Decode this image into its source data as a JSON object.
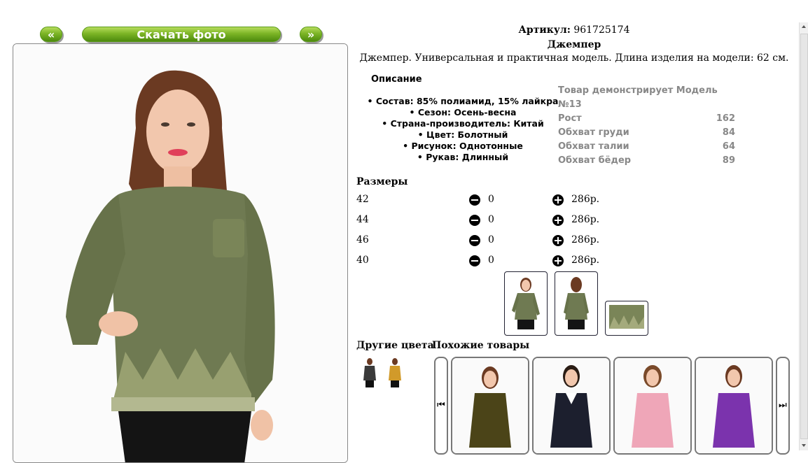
{
  "nav": {
    "prev_label": "«",
    "download_label": "Скачать фото",
    "next_label": "»"
  },
  "product": {
    "article_label": "Артикул:",
    "article_value": "961725174",
    "name": "Джемпер",
    "description": "Джемпер. Универсальная и практичная модель. Длина изделия на модели: 62 см."
  },
  "description_section": {
    "heading": "Описание",
    "properties": [
      "• Состав: 85% полиамид, 15% лайкра",
      "• Сезон: Осень-весна",
      "• Страна-производитель: Китай",
      "• Цвет: Болотный",
      "• Рисунок: Однотонные",
      "• Рукав: Длинный"
    ]
  },
  "model_info": {
    "title": "Товар демонстрирует Модель №13",
    "rows": [
      {
        "label": "Рост",
        "value": "162"
      },
      {
        "label": "Обхват груди",
        "value": "84"
      },
      {
        "label": "Обхват талии",
        "value": "64"
      },
      {
        "label": "Обхват бёдер",
        "value": "89"
      }
    ]
  },
  "sizes": {
    "heading": "Размеры",
    "rows": [
      {
        "size": "42",
        "qty": "0",
        "price": "286р."
      },
      {
        "size": "44",
        "qty": "0",
        "price": "286р."
      },
      {
        "size": "46",
        "qty": "0",
        "price": "286р."
      },
      {
        "size": "40",
        "qty": "0",
        "price": "286р."
      }
    ]
  },
  "other_colors": {
    "heading": "Другие цвета",
    "swatches": [
      "#3a3a3a",
      "#d19a2a"
    ]
  },
  "similar": {
    "heading": "Похожие товары",
    "prev_icon": "skip-previous-icon",
    "next_icon": "skip-next-icon",
    "items": [
      {
        "color": "#4b4418"
      },
      {
        "color": "#1c1f2e"
      },
      {
        "color": "#efa6b8"
      },
      {
        "color": "#7b33ad"
      }
    ]
  },
  "colors": {
    "sweater": "#6f7a52",
    "accent_green": "#7cb526"
  }
}
